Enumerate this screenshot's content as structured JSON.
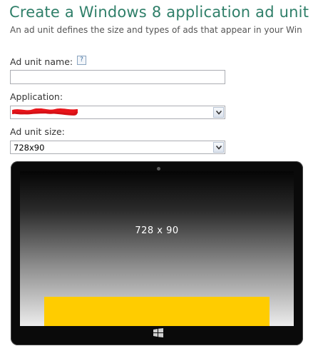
{
  "page": {
    "title": "Create a Windows 8 application ad unit",
    "subtitle": "An ad unit defines the size and types of ads that appear in your Win"
  },
  "form": {
    "ad_unit_name": {
      "label": "Ad unit name:",
      "help_glyph": "?",
      "value": ""
    },
    "application": {
      "label": "Application:",
      "selected_value_redacted": true
    },
    "ad_unit_size": {
      "label": "Ad unit size:",
      "selected_value": "728x90"
    }
  },
  "preview": {
    "ad_size_label": "728 x 90",
    "ad_banner_color": "#ffcc00",
    "device": "windows-8-tablet"
  },
  "colors": {
    "title": "#2f7f69",
    "redaction": "#e8141a"
  }
}
